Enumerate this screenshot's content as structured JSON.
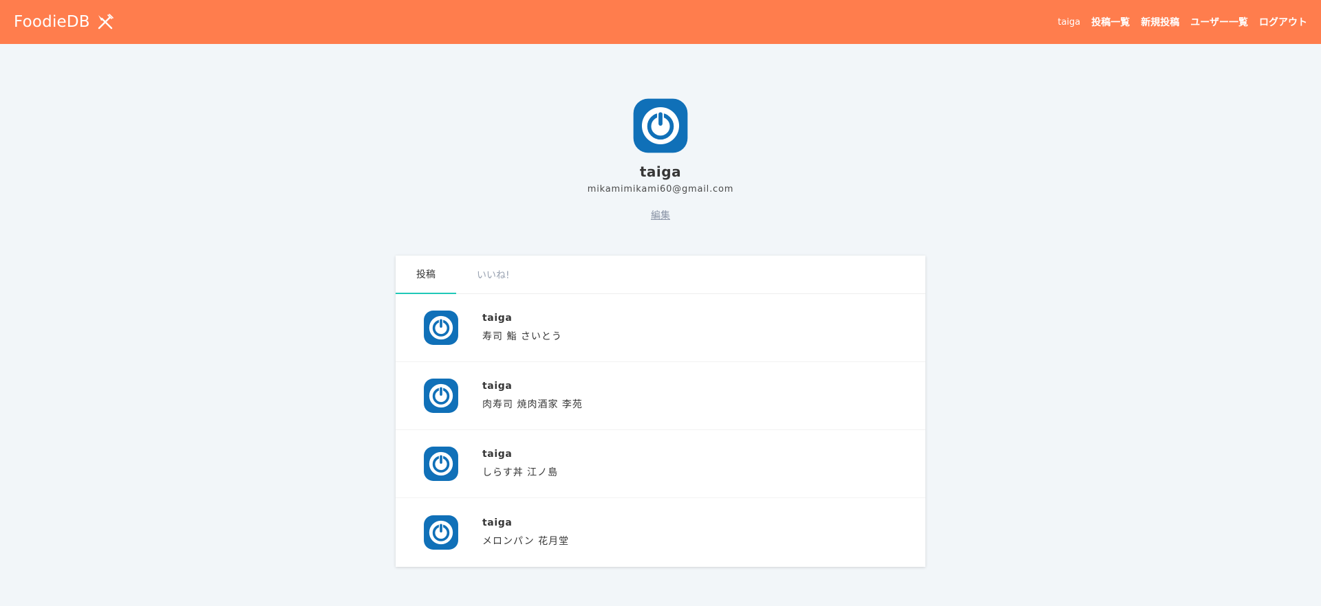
{
  "navbar": {
    "brand": "FoodieDB",
    "brand_icon": "fork-knife-icon",
    "links": [
      {
        "label": "taiga"
      },
      {
        "label": "投稿一覧"
      },
      {
        "label": "新規投稿"
      },
      {
        "label": "ユーザー一覧"
      },
      {
        "label": "ログアウト"
      }
    ]
  },
  "profile": {
    "avatar_icon": "power-button-avatar-icon",
    "name": "taiga",
    "email": "mikamimikami60@gmail.com",
    "edit_label": "編集"
  },
  "tabs": [
    {
      "label": "投稿",
      "active": true
    },
    {
      "label": "いいね!",
      "active": false
    }
  ],
  "posts": [
    {
      "user": "taiga",
      "title": "寿司 鮨 さいとう"
    },
    {
      "user": "taiga",
      "title": "肉寿司 焼肉酒家 李苑"
    },
    {
      "user": "taiga",
      "title": "しらす丼 江ノ島"
    },
    {
      "user": "taiga",
      "title": "メロンパン 花月堂"
    }
  ],
  "colors": {
    "navbar": "#ff7d4d",
    "background": "#f2f6f9",
    "tab_underline": "#1fc8b8",
    "avatar_blue": "#1070b8"
  }
}
